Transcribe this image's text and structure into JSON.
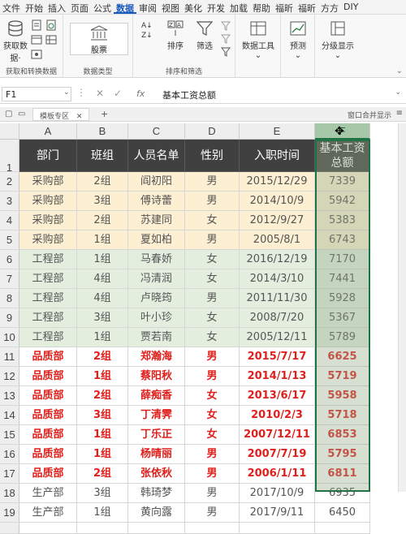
{
  "ribbon_tabs": [
    "文件",
    "开始",
    "插入",
    "页面",
    "公式",
    "数据",
    "审阅",
    "视图",
    "美化",
    "开发",
    "加载",
    "帮助",
    "福昕",
    "福昕",
    "方方",
    "DIY"
  ],
  "ribbon_groups": {
    "get_transform": {
      "btn1": "获取数",
      "btn1b": "据·",
      "label": "获取和转换数据"
    },
    "data_types": {
      "btn": "股票",
      "label": "数据类型"
    },
    "sort_filter": {
      "sort": "排序",
      "filter": "筛选",
      "label": "排序和筛选"
    },
    "data_tools": {
      "btn": "数据工具"
    },
    "forecast": {
      "btn": "预测"
    },
    "outline": {
      "btn": "分级显示"
    }
  },
  "formula_bar": {
    "cell_ref": "F1",
    "fx": "fx",
    "content": "基本工资总额"
  },
  "sheet_bar": {
    "tab": "模板专区",
    "plus": "+",
    "right": "窗口合并显示"
  },
  "columns": [
    "A",
    "B",
    "C",
    "D",
    "E",
    "F"
  ],
  "header_row": [
    "部门",
    "班组",
    "人员名单",
    "性别",
    "入职时间",
    "基本工资\n总额"
  ],
  "header_row_f_line1": "基本工资",
  "header_row_f_line2": "总额",
  "rows": [
    {
      "n": "2",
      "dept": "采购部",
      "team": "2组",
      "name": "阎初阳",
      "sex": "男",
      "date": "2015/12/29",
      "pay": "7339",
      "group": "buy"
    },
    {
      "n": "3",
      "dept": "采购部",
      "team": "3组",
      "name": "傅诗蕾",
      "sex": "男",
      "date": "2014/10/9",
      "pay": "5942",
      "group": "buy"
    },
    {
      "n": "4",
      "dept": "采购部",
      "team": "2组",
      "name": "苏建同",
      "sex": "女",
      "date": "2012/9/27",
      "pay": "5383",
      "group": "buy"
    },
    {
      "n": "5",
      "dept": "采购部",
      "team": "1组",
      "name": "夏如柏",
      "sex": "男",
      "date": "2005/8/1",
      "pay": "6743",
      "group": "buy"
    },
    {
      "n": "6",
      "dept": "工程部",
      "team": "1组",
      "name": "马春娇",
      "sex": "女",
      "date": "2016/12/19",
      "pay": "7170",
      "group": "eng"
    },
    {
      "n": "7",
      "dept": "工程部",
      "team": "4组",
      "name": "冯清润",
      "sex": "女",
      "date": "2014/3/10",
      "pay": "7441",
      "group": "eng"
    },
    {
      "n": "8",
      "dept": "工程部",
      "team": "4组",
      "name": "卢晓筠",
      "sex": "男",
      "date": "2011/11/30",
      "pay": "5928",
      "group": "eng"
    },
    {
      "n": "9",
      "dept": "工程部",
      "team": "3组",
      "name": "叶小珍",
      "sex": "女",
      "date": "2008/7/20",
      "pay": "5367",
      "group": "eng"
    },
    {
      "n": "10",
      "dept": "工程部",
      "team": "1组",
      "name": "贾若南",
      "sex": "女",
      "date": "2005/12/11",
      "pay": "5789",
      "group": "eng"
    },
    {
      "n": "11",
      "dept": "品质部",
      "team": "2组",
      "name": "郑瀚海",
      "sex": "男",
      "date": "2015/7/17",
      "pay": "6625",
      "group": "qa"
    },
    {
      "n": "12",
      "dept": "品质部",
      "team": "1组",
      "name": "蔡阳秋",
      "sex": "男",
      "date": "2014/1/13",
      "pay": "5719",
      "group": "qa"
    },
    {
      "n": "13",
      "dept": "品质部",
      "team": "2组",
      "name": "薛痴香",
      "sex": "女",
      "date": "2013/6/17",
      "pay": "5958",
      "group": "qa"
    },
    {
      "n": "14",
      "dept": "品质部",
      "team": "3组",
      "name": "丁清霁",
      "sex": "女",
      "date": "2010/2/3",
      "pay": "5718",
      "group": "qa"
    },
    {
      "n": "15",
      "dept": "品质部",
      "team": "1组",
      "name": "丁乐正",
      "sex": "女",
      "date": "2007/12/11",
      "pay": "6853",
      "group": "qa"
    },
    {
      "n": "16",
      "dept": "品质部",
      "team": "1组",
      "name": "杨晴丽",
      "sex": "男",
      "date": "2007/7/19",
      "pay": "5795",
      "group": "qa"
    },
    {
      "n": "17",
      "dept": "品质部",
      "team": "2组",
      "name": "张依秋",
      "sex": "男",
      "date": "2006/1/11",
      "pay": "6811",
      "group": "qa"
    },
    {
      "n": "18",
      "dept": "生产部",
      "team": "3组",
      "name": "韩琦梦",
      "sex": "男",
      "date": "2017/10/9",
      "pay": "6935",
      "group": "prod"
    },
    {
      "n": "19",
      "dept": "生产部",
      "team": "1组",
      "name": "黄向露",
      "sex": "男",
      "date": "2017/9/11",
      "pay": "6450",
      "group": "prod"
    }
  ],
  "colors": {
    "buy_bg": "#fcefd2",
    "eng_bg": "#e3eedf",
    "qa_text": "#e0201c",
    "normal_text": "#555555",
    "header_bg": "#404040"
  }
}
